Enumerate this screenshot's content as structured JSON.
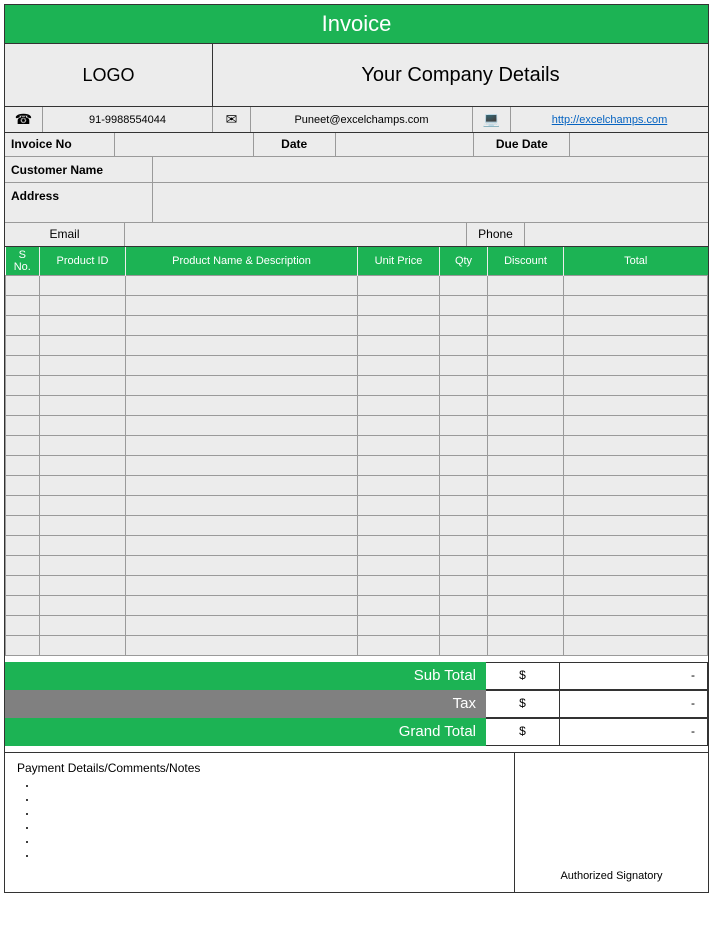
{
  "title": "Invoice",
  "logo_label": "LOGO",
  "company_label": "Your Company Details",
  "contact": {
    "phone": "91-9988554044",
    "email": "Puneet@excelchamps.com",
    "web": "http://excelchamps.com"
  },
  "labels": {
    "invoice_no": "Invoice No",
    "date": "Date",
    "due_date": "Due Date",
    "customer_name": "Customer Name",
    "address": "Address",
    "email": "Email",
    "phone": "Phone"
  },
  "columns": {
    "sno": "S No.",
    "product_id": "Product ID",
    "product_name": "Product Name & Description",
    "unit_price": "Unit Price",
    "qty": "Qty",
    "discount": "Discount",
    "total": "Total"
  },
  "totals": {
    "sub_total_label": "Sub Total",
    "tax_label": "Tax",
    "grand_total_label": "Grand Total",
    "currency": "$",
    "dash": "-"
  },
  "footer": {
    "notes_label": "Payment Details/Comments/Notes",
    "signatory": "Authorized Signatory"
  },
  "row_count": 19
}
